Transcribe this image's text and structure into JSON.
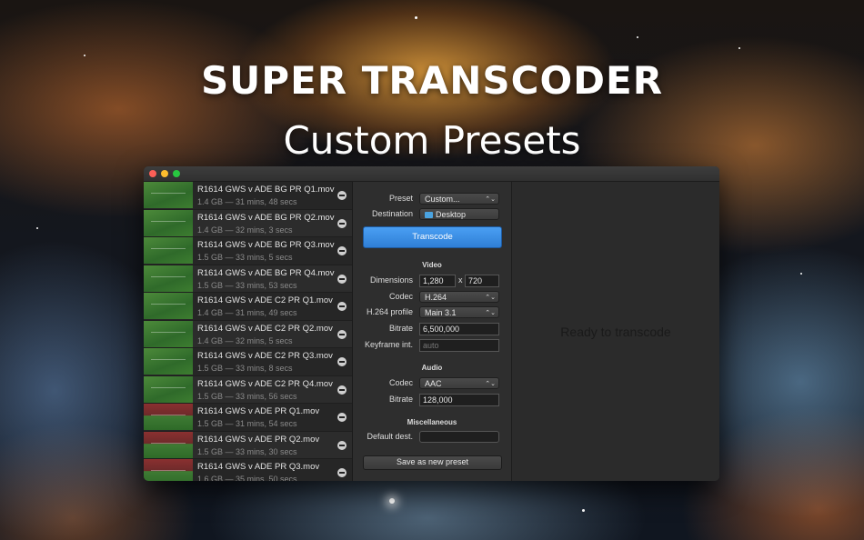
{
  "hero": {
    "title": "SUPER TRANSCODER",
    "subtitle": "Custom Presets"
  },
  "window": {
    "files": [
      {
        "name": "R1614 GWS v ADE BG PR Q1.mov",
        "meta": "1.4 GB — 31 mins, 48 secs",
        "thumb": "field"
      },
      {
        "name": "R1614 GWS v ADE BG PR Q2.mov",
        "meta": "1.4 GB — 32 mins, 3 secs",
        "thumb": "field"
      },
      {
        "name": "R1614 GWS v ADE BG PR Q3.mov",
        "meta": "1.5 GB — 33 mins, 5 secs",
        "thumb": "field"
      },
      {
        "name": "R1614 GWS v ADE BG PR Q4.mov",
        "meta": "1.5 GB — 33 mins, 53 secs",
        "thumb": "field"
      },
      {
        "name": "R1614 GWS v ADE C2 PR Q1.mov",
        "meta": "1.4 GB — 31 mins, 49 secs",
        "thumb": "field"
      },
      {
        "name": "R1614 GWS v ADE C2 PR Q2.mov",
        "meta": "1.4 GB — 32 mins, 5 secs",
        "thumb": "field"
      },
      {
        "name": "R1614 GWS v ADE C2 PR Q3.mov",
        "meta": "1.5 GB — 33 mins, 8 secs",
        "thumb": "field"
      },
      {
        "name": "R1614 GWS v ADE C2 PR Q4.mov",
        "meta": "1.5 GB — 33 mins, 56 secs",
        "thumb": "field"
      },
      {
        "name": "R1614 GWS v ADE PR Q1.mov",
        "meta": "1.5 GB — 31 mins, 54 secs",
        "thumb": "crowd"
      },
      {
        "name": "R1614 GWS v ADE PR Q2.mov",
        "meta": "1.5 GB — 33 mins, 30 secs",
        "thumb": "crowd"
      },
      {
        "name": "R1614 GWS v ADE PR Q3.mov",
        "meta": "1.6 GB — 35 mins, 50 secs",
        "thumb": "crowd"
      }
    ],
    "settings": {
      "preset_label": "Preset",
      "preset_value": "Custom...",
      "destination_label": "Destination",
      "destination_value": "Desktop",
      "transcode_label": "Transcode",
      "video_section": "Video",
      "dimensions_label": "Dimensions",
      "width": "1,280",
      "x_sep": "x",
      "height": "720",
      "codec_label": "Codec",
      "video_codec": "H.264",
      "profile_label": "H.264 profile",
      "profile_value": "Main 3.1",
      "bitrate_label": "Bitrate",
      "video_bitrate": "6,500,000",
      "keyframe_label": "Keyframe int.",
      "keyframe_placeholder": "auto",
      "audio_section": "Audio",
      "audio_codec_label": "Codec",
      "audio_codec": "AAC",
      "audio_bitrate_label": "Bitrate",
      "audio_bitrate": "128,000",
      "misc_section": "Miscellaneous",
      "default_dest_label": "Default dest.",
      "default_dest_value": "",
      "save_preset_label": "Save as new preset"
    },
    "status": "Ready to transcode"
  }
}
